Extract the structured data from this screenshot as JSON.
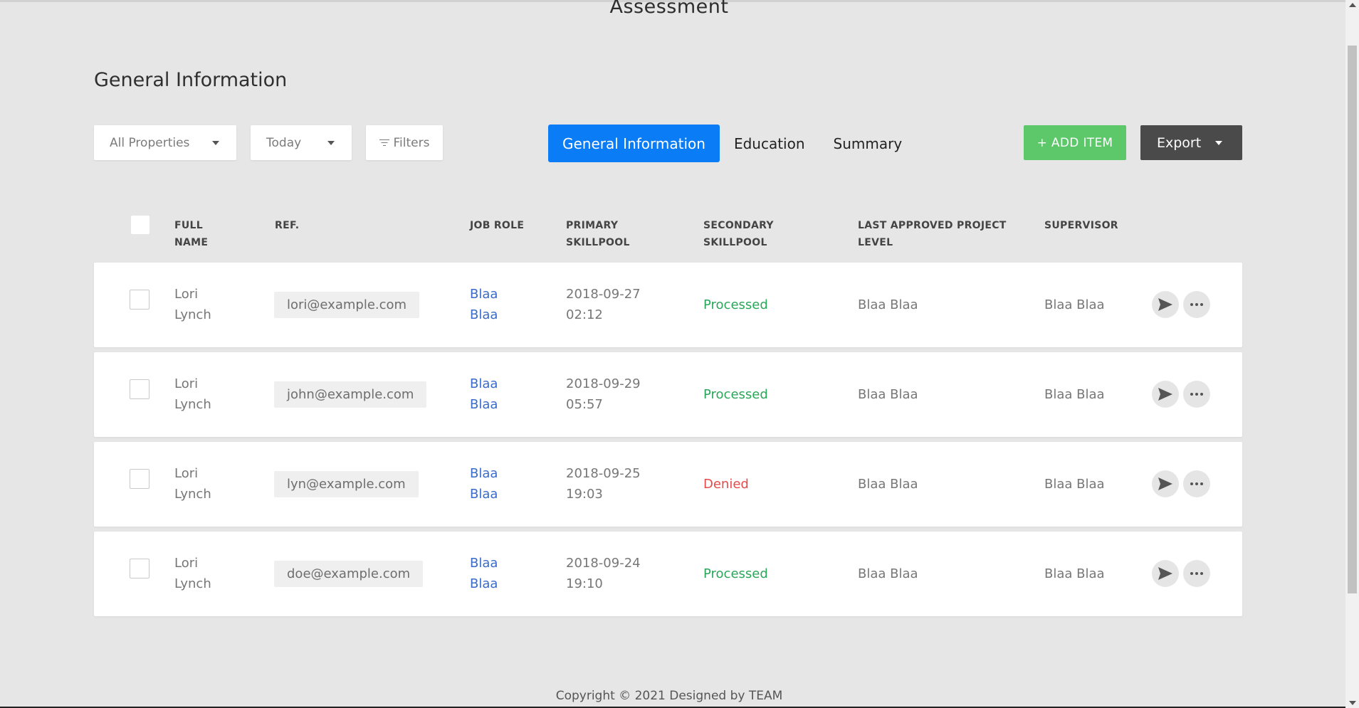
{
  "header": {
    "title": "Assessment"
  },
  "section_title": "General Information",
  "toolbar": {
    "properties_value": "All Properties",
    "date_value": "Today",
    "filters_label": "Filters",
    "add_label": "+ ADD ITEM",
    "export_label": "Export"
  },
  "tabs": [
    {
      "label": "General Information",
      "active": true
    },
    {
      "label": "Education",
      "active": false
    },
    {
      "label": "Summary",
      "active": false
    }
  ],
  "columns": {
    "full_name": [
      "FULL",
      "NAME"
    ],
    "ref": "REF.",
    "job_role": "JOB ROLE",
    "primary": [
      "PRIMARY",
      "SKILLPOOL"
    ],
    "secondary": [
      "SECONDARY",
      "SKILLPOOL"
    ],
    "last_level": [
      "LAST APPROVED PROJECT",
      "LEVEL"
    ],
    "supervisor": "SUPERVISOR"
  },
  "rows": [
    {
      "first": "Lori",
      "last": "Lynch",
      "email": "lori@example.com",
      "job1": "Blaa",
      "job2": "Blaa",
      "date": "2018-09-27",
      "time": "02:12",
      "status": "Processed",
      "level": "Blaa Blaa",
      "supervisor": "Blaa Blaa"
    },
    {
      "first": "Lori",
      "last": "Lynch",
      "email": "john@example.com",
      "job1": "Blaa",
      "job2": "Blaa",
      "date": "2018-09-29",
      "time": "05:57",
      "status": "Processed",
      "level": "Blaa Blaa",
      "supervisor": "Blaa Blaa"
    },
    {
      "first": "Lori",
      "last": "Lynch",
      "email": "lyn@example.com",
      "job1": "Blaa",
      "job2": "Blaa",
      "date": "2018-09-25",
      "time": "19:03",
      "status": "Denied",
      "level": "Blaa Blaa",
      "supervisor": "Blaa Blaa"
    },
    {
      "first": "Lori",
      "last": "Lynch",
      "email": "doe@example.com",
      "job1": "Blaa",
      "job2": "Blaa",
      "date": "2018-09-24",
      "time": "19:10",
      "status": "Processed",
      "level": "Blaa Blaa",
      "supervisor": "Blaa Blaa"
    }
  ],
  "footer": {
    "text": "Copyright © 2021 Designed by TEAM"
  },
  "colors": {
    "primary": "#0a7cf6",
    "success": "#5cc86a",
    "processed": "#2aa65a",
    "denied": "#e54b4b",
    "dark": "#4a4a4a"
  }
}
